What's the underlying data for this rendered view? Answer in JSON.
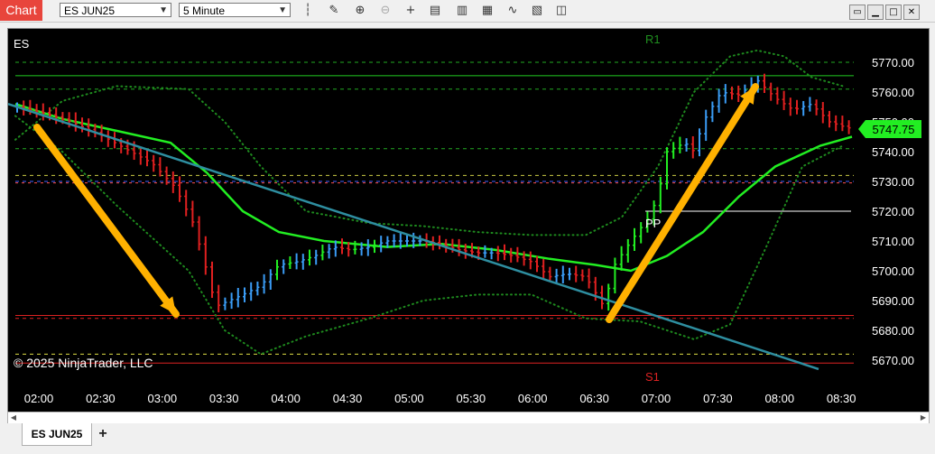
{
  "window": {
    "brand": "Chart",
    "instrument": "ES JUN25",
    "interval": "5 Minute"
  },
  "toolbar": {
    "icons": [
      "bar-type-icon",
      "draw-pencil-icon",
      "zoom-in-icon",
      "zoom-out-icon",
      "crosshair-icon",
      "properties-icon",
      "data-series-icon",
      "indicators-icon",
      "strategies-icon",
      "templates-icon",
      "chart-trader-icon"
    ]
  },
  "chart": {
    "symbol_label": "ES",
    "copyright": "© 2025 NinjaTrader, LLC",
    "price_axis": [
      "5770.00",
      "5760.00",
      "5750.00",
      "5740.00",
      "5730.00",
      "5720.00",
      "5710.00",
      "5700.00",
      "5690.00",
      "5680.00",
      "5670.00"
    ],
    "time_axis": [
      "02:00",
      "02:30",
      "03:00",
      "03:30",
      "04:00",
      "04:30",
      "05:00",
      "05:30",
      "06:00",
      "06:30",
      "07:00",
      "07:30",
      "08:00",
      "08:30"
    ],
    "last_price": "5747.75",
    "pivot_labels": {
      "r1": "R1",
      "pp": "PP",
      "s1": "S1"
    },
    "colors": {
      "background": "#000000",
      "up_bar": "#3a9cf5",
      "down_bar": "#e02020",
      "up_strong": "#22ee22",
      "trendline": "#2e8ea0",
      "arrow": "#ffb100",
      "last_price_bg": "#22ee22"
    }
  },
  "tabs": {
    "active": "ES JUN25",
    "add_label": "+"
  },
  "window_controls": [
    "restore-icon",
    "minimize-icon",
    "maximize-icon",
    "close-icon"
  ]
}
